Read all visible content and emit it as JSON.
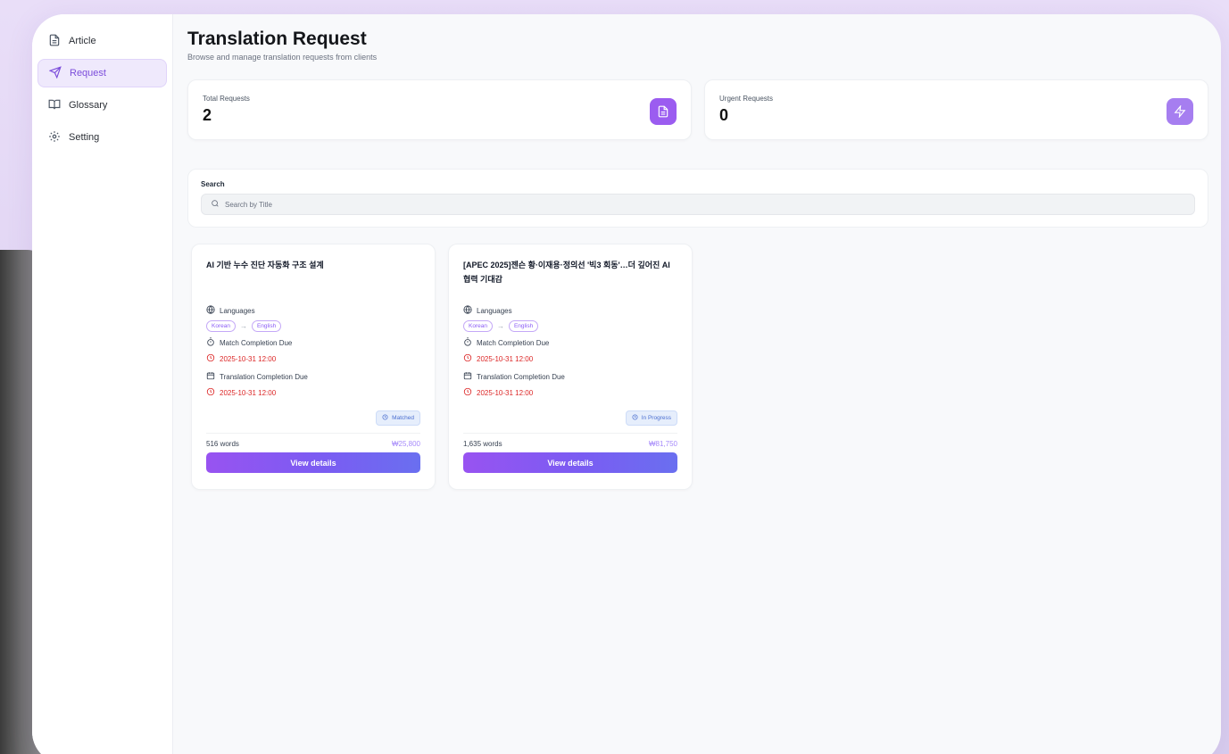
{
  "sidebar": {
    "items": [
      {
        "label": "Article",
        "icon": "file-text-icon",
        "active": false
      },
      {
        "label": "Request",
        "icon": "send-icon",
        "active": true
      },
      {
        "label": "Glossary",
        "icon": "book-icon",
        "active": false
      },
      {
        "label": "Setting",
        "icon": "gear-icon",
        "active": false
      }
    ]
  },
  "header": {
    "title": "Translation Request",
    "subtitle": "Browse and manage translation requests from clients"
  },
  "stats": {
    "total": {
      "label": "Total Requests",
      "value": "2",
      "icon": "document-icon"
    },
    "urgent": {
      "label": "Urgent Requests",
      "value": "0",
      "icon": "lightning-icon"
    }
  },
  "search": {
    "label": "Search",
    "placeholder": "Search by Title"
  },
  "requests": [
    {
      "title": "AI 기반 누수 진단 자동화 구조 설계",
      "languages_label": "Languages",
      "source_lang": "Korean",
      "target_lang": "English",
      "match_label": "Match Completion Due",
      "match_due": "2025-10-31 12:00",
      "translation_label": "Translation Completion Due",
      "translation_due": "2025-10-31 12:00",
      "status": "Matched",
      "words": "516 words",
      "price": "₩25,800",
      "button": "View details"
    },
    {
      "title": "[APEC 2025]젠슨 황·이재용·정의선 '빅3 회동'…더 깊어진 AI 협력 기대감",
      "languages_label": "Languages",
      "source_lang": "Korean",
      "target_lang": "English",
      "match_label": "Match Completion Due",
      "match_due": "2025-10-31 12:00",
      "translation_label": "Translation Completion Due",
      "translation_due": "2025-10-31 12:00",
      "status": "In Progress",
      "words": "1,635 words",
      "price": "₩81,750",
      "button": "View details"
    }
  ],
  "colors": {
    "accent": "#9b5cf0",
    "due_red": "#dc2626",
    "status_blue": "#4b6fd0"
  }
}
